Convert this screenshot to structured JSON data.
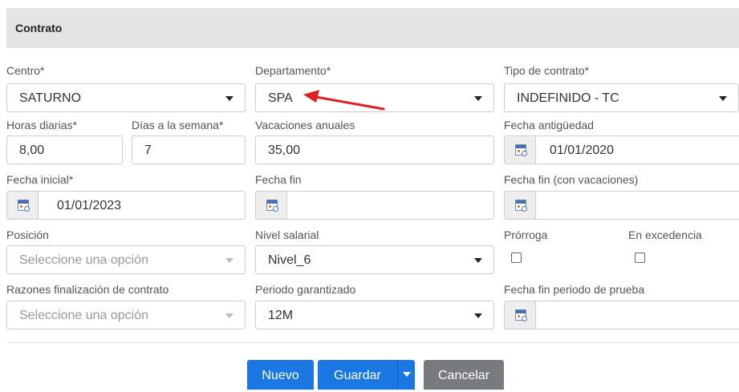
{
  "panel": {
    "title": "Contrato"
  },
  "fields": {
    "centro": {
      "label": "Centro*",
      "value": "SATURNO"
    },
    "departamento": {
      "label": "Departamento*",
      "value": "SPA"
    },
    "tipo_contrato": {
      "label": "Tipo de contrato*",
      "value": "INDEFINIDO - TC"
    },
    "horas_diarias": {
      "label": "Horas diarias*",
      "value": "8,00"
    },
    "dias_semana": {
      "label": "Días a la semana*",
      "value": "7"
    },
    "vacaciones": {
      "label": "Vacaciones anuales",
      "value": "35,00"
    },
    "fecha_antiguedad": {
      "label": "Fecha antigüedad",
      "value": "01/01/2020"
    },
    "fecha_inicial": {
      "label": "Fecha inicial*",
      "value": "01/01/2023"
    },
    "fecha_fin": {
      "label": "Fecha fin",
      "value": ""
    },
    "fecha_fin_vac": {
      "label": "Fecha fin (con vacaciones)",
      "value": ""
    },
    "posicion": {
      "label": "Posición",
      "placeholder": "Seleccione una opción"
    },
    "nivel_salarial": {
      "label": "Nivel salarial",
      "value": "Nivel_6"
    },
    "prorroga": {
      "label": "Prórroga",
      "checked": false
    },
    "excedencia": {
      "label": "En excedencia",
      "checked": false
    },
    "razones_fin": {
      "label": "Razones finalización de contrato",
      "placeholder": "Seleccione una opción"
    },
    "periodo_garantizado": {
      "label": "Periodo garantizado",
      "value": "12M"
    },
    "fecha_fin_prueba": {
      "label": "Fecha fin periodo de prueba",
      "value": ""
    }
  },
  "buttons": {
    "nuevo": "Nuevo",
    "guardar": "Guardar",
    "cancelar": "Cancelar"
  },
  "colors": {
    "primary": "#1b78e2",
    "secondary": "#777a7e",
    "annotation_arrow": "#e02020",
    "header_bg": "#e4e4e4"
  }
}
